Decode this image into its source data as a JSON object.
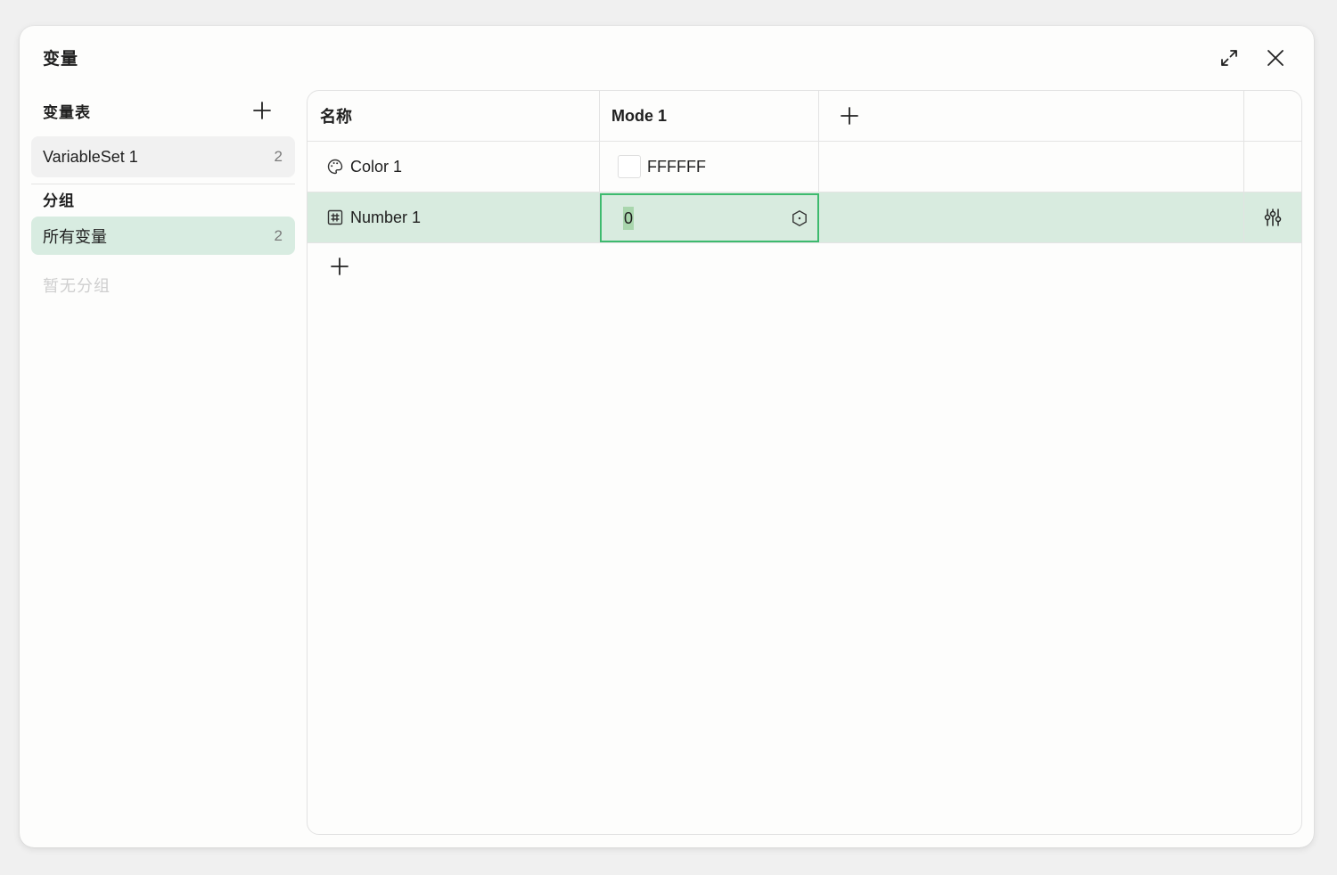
{
  "dialog": {
    "title": "变量",
    "expand_icon": "expand-icon",
    "close_icon": "close-icon"
  },
  "sidebar": {
    "sets_heading": "变量表",
    "add_icon": "plus-icon",
    "sets": [
      {
        "label": "VariableSet 1",
        "count": "2"
      }
    ],
    "groups_heading": "分组",
    "groups": [
      {
        "label": "所有变量",
        "count": "2",
        "selected": true
      }
    ],
    "empty_groups_text": "暂无分组"
  },
  "table": {
    "headers": {
      "name": "名称",
      "mode": "Mode 1"
    },
    "rows": [
      {
        "type_icon": "palette-icon",
        "name": "Color 1",
        "value": "FFFFFF",
        "swatch_color": "#FFFFFF"
      },
      {
        "type_icon": "hash-icon",
        "name": "Number 1",
        "value": "0",
        "editing": true,
        "value_action_icon": "hexagon-dot-icon",
        "row_action_icon": "sliders-icon"
      }
    ]
  },
  "colors": {
    "selected_bg": "#d8ebdf",
    "focus_border": "#3dba6e"
  }
}
